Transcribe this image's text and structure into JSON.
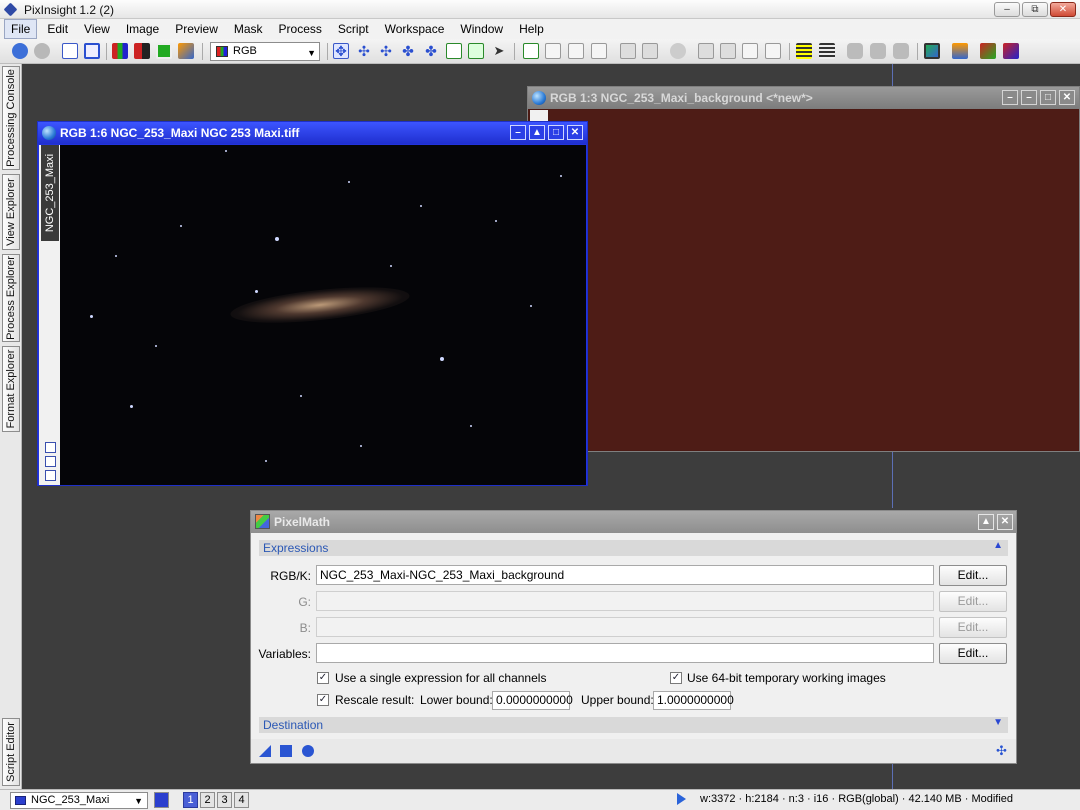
{
  "app": {
    "title": "PixInsight 1.2 (2)",
    "window_buttons": [
      "–",
      "⧉",
      "✕"
    ]
  },
  "menu": [
    "File",
    "Edit",
    "View",
    "Image",
    "Preview",
    "Mask",
    "Process",
    "Script",
    "Workspace",
    "Window",
    "Help"
  ],
  "toolbar": {
    "channel_select": "RGB"
  },
  "sidebar": {
    "tabs": [
      "Processing Console",
      "View Explorer",
      "Process Explorer",
      "Format Explorer",
      "Script Editor"
    ]
  },
  "image_windows": {
    "ngc": {
      "title": "RGB 1:6 NGC_253_Maxi NGC 253 Maxi.tiff",
      "view_id": "NGC_253_Maxi",
      "buttons": [
        "–",
        "▲",
        "□",
        "✕"
      ]
    },
    "background": {
      "title": "RGB 1:3 NGC_253_Maxi_background <*new*>",
      "buttons": [
        "–",
        "–",
        "□",
        "✕"
      ]
    }
  },
  "pixelmath": {
    "title": "PixelMath",
    "title_buttons": [
      "▲",
      "✕"
    ],
    "expressions_section": "Expressions",
    "destination_section": "Destination",
    "rgbk_label": "RGB/K:",
    "rgbk_value": "NGC_253_Maxi-NGC_253_Maxi_background",
    "g_label": "G:",
    "g_value": "",
    "b_label": "B:",
    "b_value": "",
    "variables_label": "Variables:",
    "variables_value": "",
    "edit_label": "Edit...",
    "single_expression_label": "Use a single expression for all channels",
    "single_expression_checked": true,
    "use64_label": "Use 64-bit temporary working images",
    "use64_checked": true,
    "rescale_label": "Rescale result:",
    "rescale_checked": true,
    "lower_bound_label": "Lower bound:",
    "lower_bound_value": "0.0000000000",
    "upper_bound_label": "Upper bound:",
    "upper_bound_value": "1.0000000000"
  },
  "statusbar": {
    "view": "NGC_253_Maxi",
    "workspaces": [
      "1",
      "2",
      "3",
      "4"
    ],
    "active_workspace": "1",
    "info": "w:3372 · h:2184 · n:3 · i16 · RGB(global) · 42.140 MB · Modified"
  }
}
